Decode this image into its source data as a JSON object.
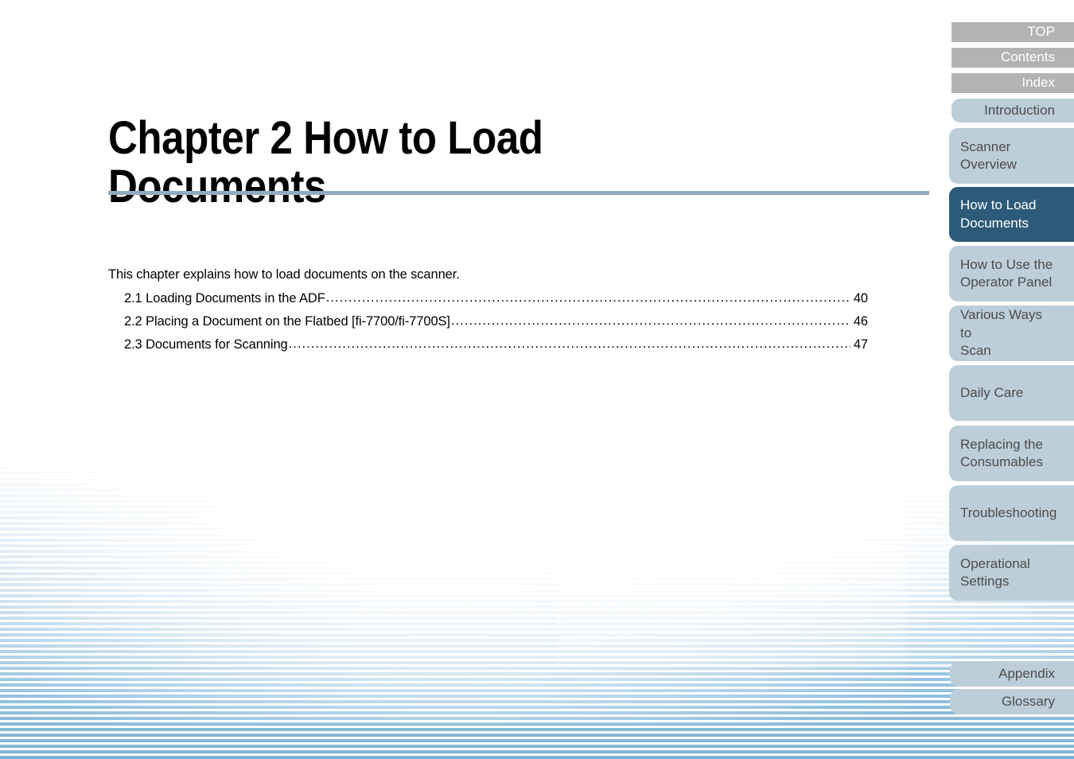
{
  "document": {
    "chapter_title": "Chapter 2   How to Load\nDocuments",
    "intro": "This chapter explains how to load documents on the scanner.",
    "rule_color": "#95a9bd"
  },
  "toc": {
    "dots": "........................................................................................................................................................................................................................................",
    "entries": [
      {
        "label": "2.1 Loading Documents in the ADF",
        "page": "40"
      },
      {
        "label": "2.2 Placing a Document on the Flatbed [fi-7700/fi-7700S]",
        "page": "46"
      },
      {
        "label": "2.3 Documents for Scanning",
        "page": "47"
      }
    ]
  },
  "sidebar": {
    "colors": {
      "gray_tab": "#b3b3b3",
      "light_tab": "#bcced9",
      "active_tab": "#2c5a78",
      "tab_text": "#4d4d4d",
      "tab_text_on_dark": "#ffffff"
    },
    "top_items": [
      {
        "label": "TOP"
      },
      {
        "label": "Contents"
      },
      {
        "label": "Index"
      }
    ],
    "items": [
      {
        "label": "Introduction",
        "state": "normal",
        "align": "right"
      },
      {
        "label": "Scanner\nOverview",
        "state": "normal",
        "align": "left"
      },
      {
        "label": "How to Load\nDocuments",
        "state": "active",
        "align": "left"
      },
      {
        "label": "How to Use the\nOperator Panel",
        "state": "normal",
        "align": "left"
      },
      {
        "label": "Various Ways to\nScan",
        "state": "normal",
        "align": "left"
      },
      {
        "label": "Daily Care",
        "state": "normal",
        "align": "left"
      },
      {
        "label": "Replacing the\nConsumables",
        "state": "normal",
        "align": "left"
      },
      {
        "label": "Troubleshooting",
        "state": "normal",
        "align": "left"
      },
      {
        "label": "Operational\nSettings",
        "state": "normal",
        "align": "left"
      }
    ],
    "bottom_items": [
      {
        "label": "Appendix",
        "align": "right"
      },
      {
        "label": "Glossary",
        "align": "right"
      }
    ]
  }
}
